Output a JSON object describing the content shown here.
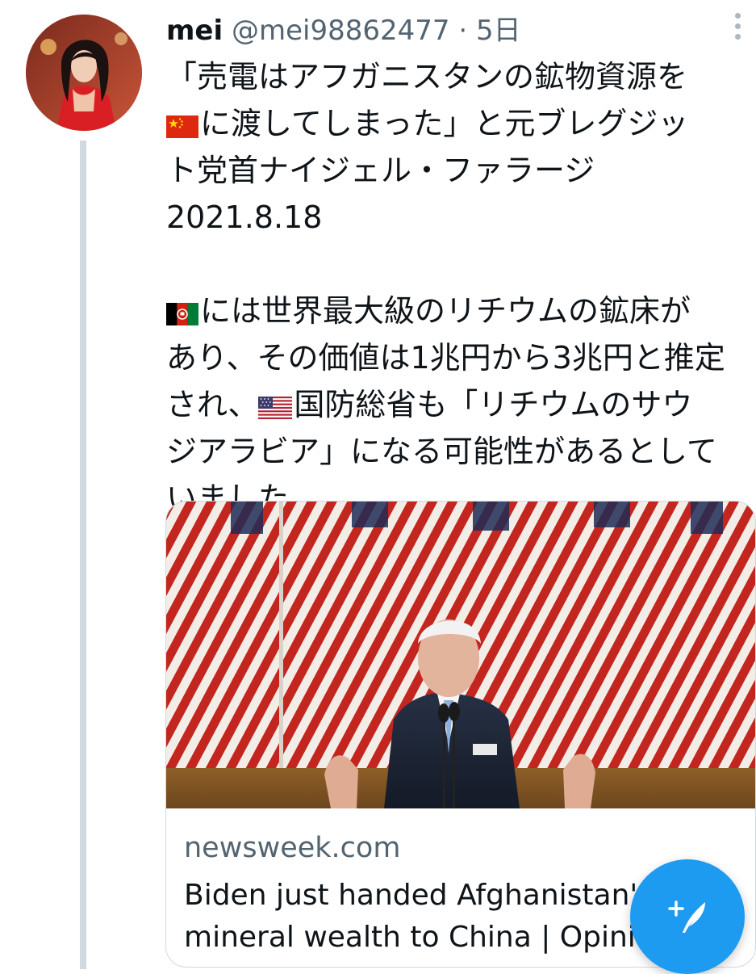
{
  "tweet": {
    "author_name": "mei",
    "handle": "@mei98862477",
    "separator": "·",
    "time": "5日",
    "text_lines": [
      "「売電はアフガニスタンの鉱物資源を",
      "に渡してしまった」と元ブレグジッ",
      "ト党首ナイジェル・ファラージ",
      "2021.8.18",
      "",
      "には世界最大級のリチウムの鉱床が",
      "あり、その価値は1兆円から3兆円と推定",
      "され、",
      "国防総省も「リチウムのサウ",
      "ジアラビア」になる可能性があるとして",
      "いました"
    ]
  },
  "card": {
    "domain": "newsweek.com",
    "title_line1": "Biden just handed Afghanistan's",
    "title_line2": "mineral wealth to China | Opinion"
  },
  "icons": {
    "more": "more-vertical-icon",
    "compose": "compose-tweet-icon",
    "flag_cn": "china-flag-icon",
    "flag_af": "afghanistan-flag-icon",
    "flag_us": "us-flag-icon"
  },
  "colors": {
    "accent": "#1d9bf0",
    "text": "#0f1419",
    "secondary": "#536471",
    "thread_line": "#cfd9de"
  }
}
